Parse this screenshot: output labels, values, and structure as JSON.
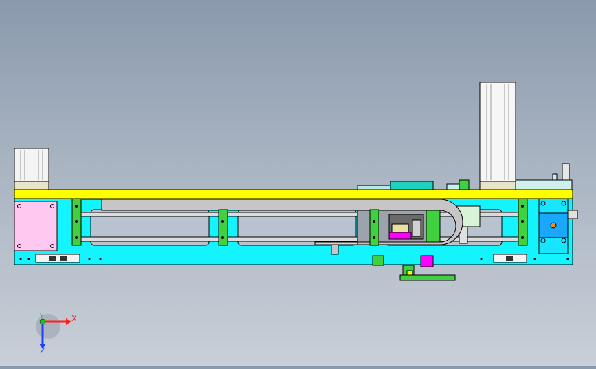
{
  "viewport": {
    "background_top": "#8a99ad",
    "background_bottom": "#c9cfd7"
  },
  "colors": {
    "base_plate": "#14f4ff",
    "top_plate": "#ffff00",
    "motor_pad": "#ffc8f0",
    "cable_chain": "#c9c9c9",
    "bracket": "#40d040",
    "magenta": "#ff00ff",
    "outline": "#000000"
  },
  "triad": {
    "x_label": "X",
    "y_label": "Y",
    "z_label": "Z",
    "x_color": "#ff2020",
    "y_color": "#20c020",
    "z_color": "#2040ff"
  }
}
